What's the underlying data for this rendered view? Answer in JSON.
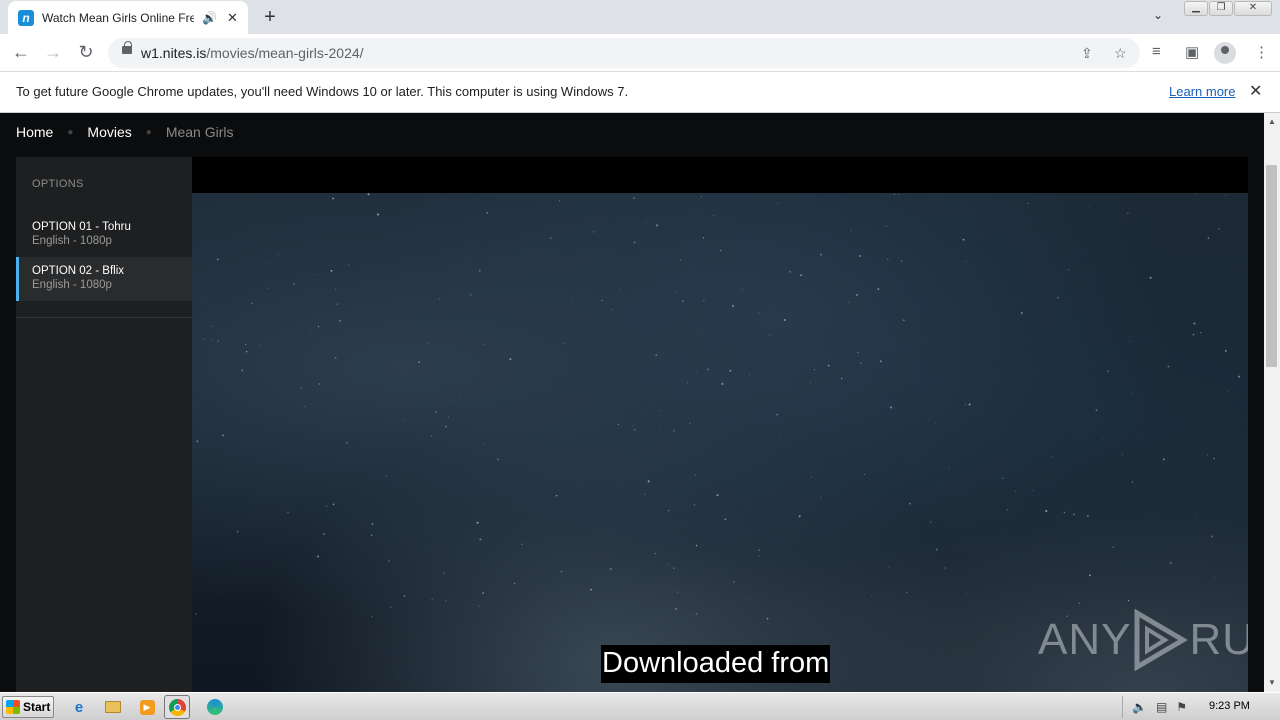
{
  "browser": {
    "tab_title": "Watch Mean Girls Online Free in",
    "favicon_letter": "n",
    "url_domain": "w1.nites.is",
    "url_path": "/movies/mean-girls-2024/",
    "window_controls": [
      "minimize",
      "restore",
      "close"
    ]
  },
  "infobar": {
    "message": "To get future Google Chrome updates, you'll need Windows 10 or later. This computer is using Windows 7.",
    "link_label": "Learn more"
  },
  "breadcrumb": {
    "home": "Home",
    "movies": "Movies",
    "current": "Mean Girls"
  },
  "sidebar": {
    "heading": "OPTIONS",
    "options": [
      {
        "name": "OPTION 01 - Tohru",
        "detail": "English - 1080p",
        "active": false
      },
      {
        "name": "OPTION 02 - Bflix",
        "detail": "English - 1080p",
        "active": true
      }
    ]
  },
  "player": {
    "subtitle": "Downloaded from",
    "watermark_left": "ANY",
    "watermark_right": "RUN"
  },
  "taskbar": {
    "start_label": "Start",
    "clock": "9:23 PM",
    "pinned_icons": [
      "internet-explorer-icon",
      "file-explorer-icon",
      "media-player-icon",
      "chrome-icon",
      "edge-icon"
    ]
  },
  "colors": {
    "accent": "#4ab2f0",
    "page_bg": "#0b0c0d",
    "sidebar_bg": "#1e1f20",
    "link": "#1a5fb4"
  }
}
